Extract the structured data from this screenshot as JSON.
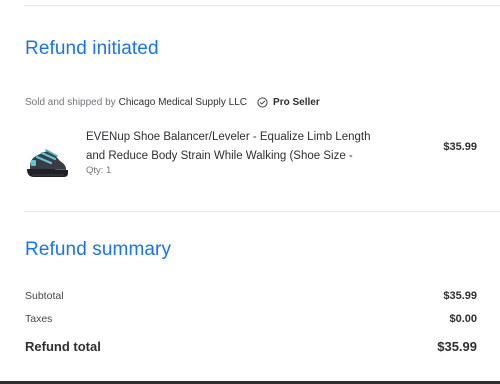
{
  "refund_status": {
    "heading": "Refund initiated",
    "seller_prefix": "Sold and shipped by",
    "seller_name": "Chicago Medical Supply LLC",
    "seller_badge_icon": "check-circle-icon",
    "seller_badge": "Pro Seller"
  },
  "item": {
    "thumbnail_icon": "shoe-balancer-product-image",
    "title": "EVENup Shoe Balancer/Leveler - Equalize Limb Length and Reduce Body Strain While Walking (Shoe Size -",
    "qty": "Qty: 1",
    "price": "$35.99"
  },
  "summary": {
    "heading": "Refund summary",
    "subtotal_label": "Subtotal",
    "subtotal_value": "$35.99",
    "taxes_label": "Taxes",
    "taxes_value": "$0.00",
    "total_label": "Refund total",
    "total_value": "$35.99"
  },
  "colors": {
    "accent": "#1a73e8",
    "text": "#2e2f32",
    "muted": "#74767c"
  }
}
